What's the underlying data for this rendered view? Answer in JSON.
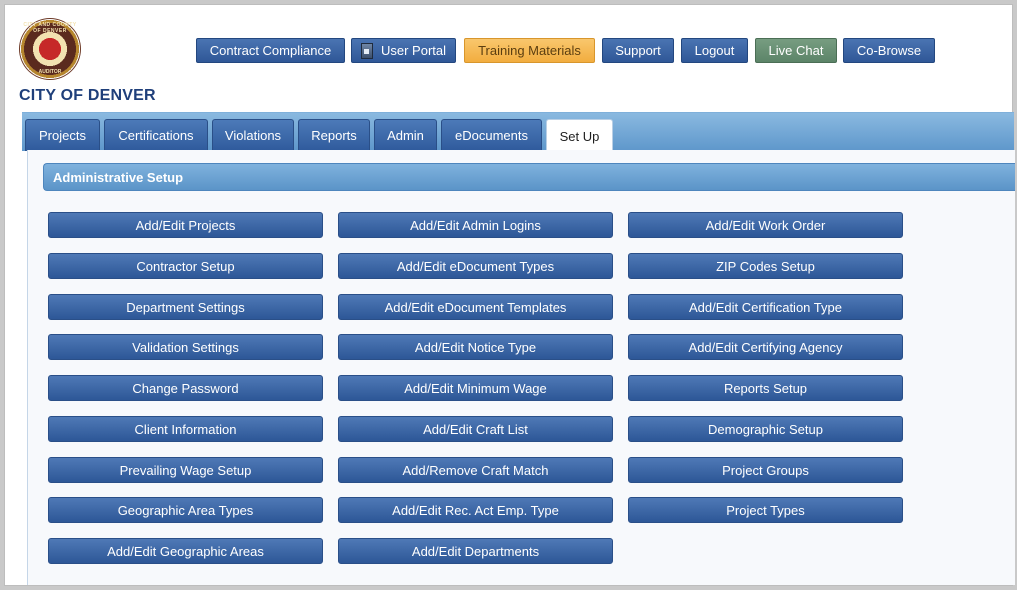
{
  "logo": {
    "seal_text": "CITY AND COUNTY OF DENVER",
    "bottom_text": "AUDITOR"
  },
  "top_nav": [
    {
      "label": "Contract Compliance"
    },
    {
      "label": "User Portal"
    },
    {
      "label": "Training Materials"
    },
    {
      "label": "Support"
    },
    {
      "label": "Logout"
    },
    {
      "label": "Live Chat"
    },
    {
      "label": "Co-Browse"
    }
  ],
  "city_title": "CITY OF DENVER",
  "tabs": [
    {
      "label": "Projects"
    },
    {
      "label": "Certifications"
    },
    {
      "label": "Violations"
    },
    {
      "label": "Reports"
    },
    {
      "label": "Admin"
    },
    {
      "label": "eDocuments"
    },
    {
      "label": "Set Up",
      "active": true
    }
  ],
  "section_title": "Administrative Setup",
  "setup_columns": [
    [
      "Add/Edit Projects",
      "Contractor Setup",
      "Department Settings",
      "Validation Settings",
      "Change Password",
      "Client Information",
      "Prevailing Wage Setup",
      "Geographic Area Types",
      "Add/Edit Geographic Areas"
    ],
    [
      "Add/Edit Admin Logins",
      "Add/Edit eDocument Types",
      "Add/Edit eDocument Templates",
      "Add/Edit Notice Type",
      "Add/Edit Minimum Wage",
      "Add/Edit Craft List",
      "Add/Remove Craft Match",
      "Add/Edit Rec. Act Emp. Type",
      "Add/Edit Departments"
    ],
    [
      "Add/Edit Work Order",
      "ZIP Codes Setup",
      "Add/Edit Certification Type",
      "Add/Edit Certifying Agency",
      "Reports Setup",
      "Demographic Setup",
      "Project Groups",
      "Project Types"
    ]
  ],
  "colors": {
    "nav_blue": "#2f5797",
    "training_orange": "#f2ad3f",
    "livechat_green": "#5c8468",
    "title_blue": "#1f3f7a"
  }
}
